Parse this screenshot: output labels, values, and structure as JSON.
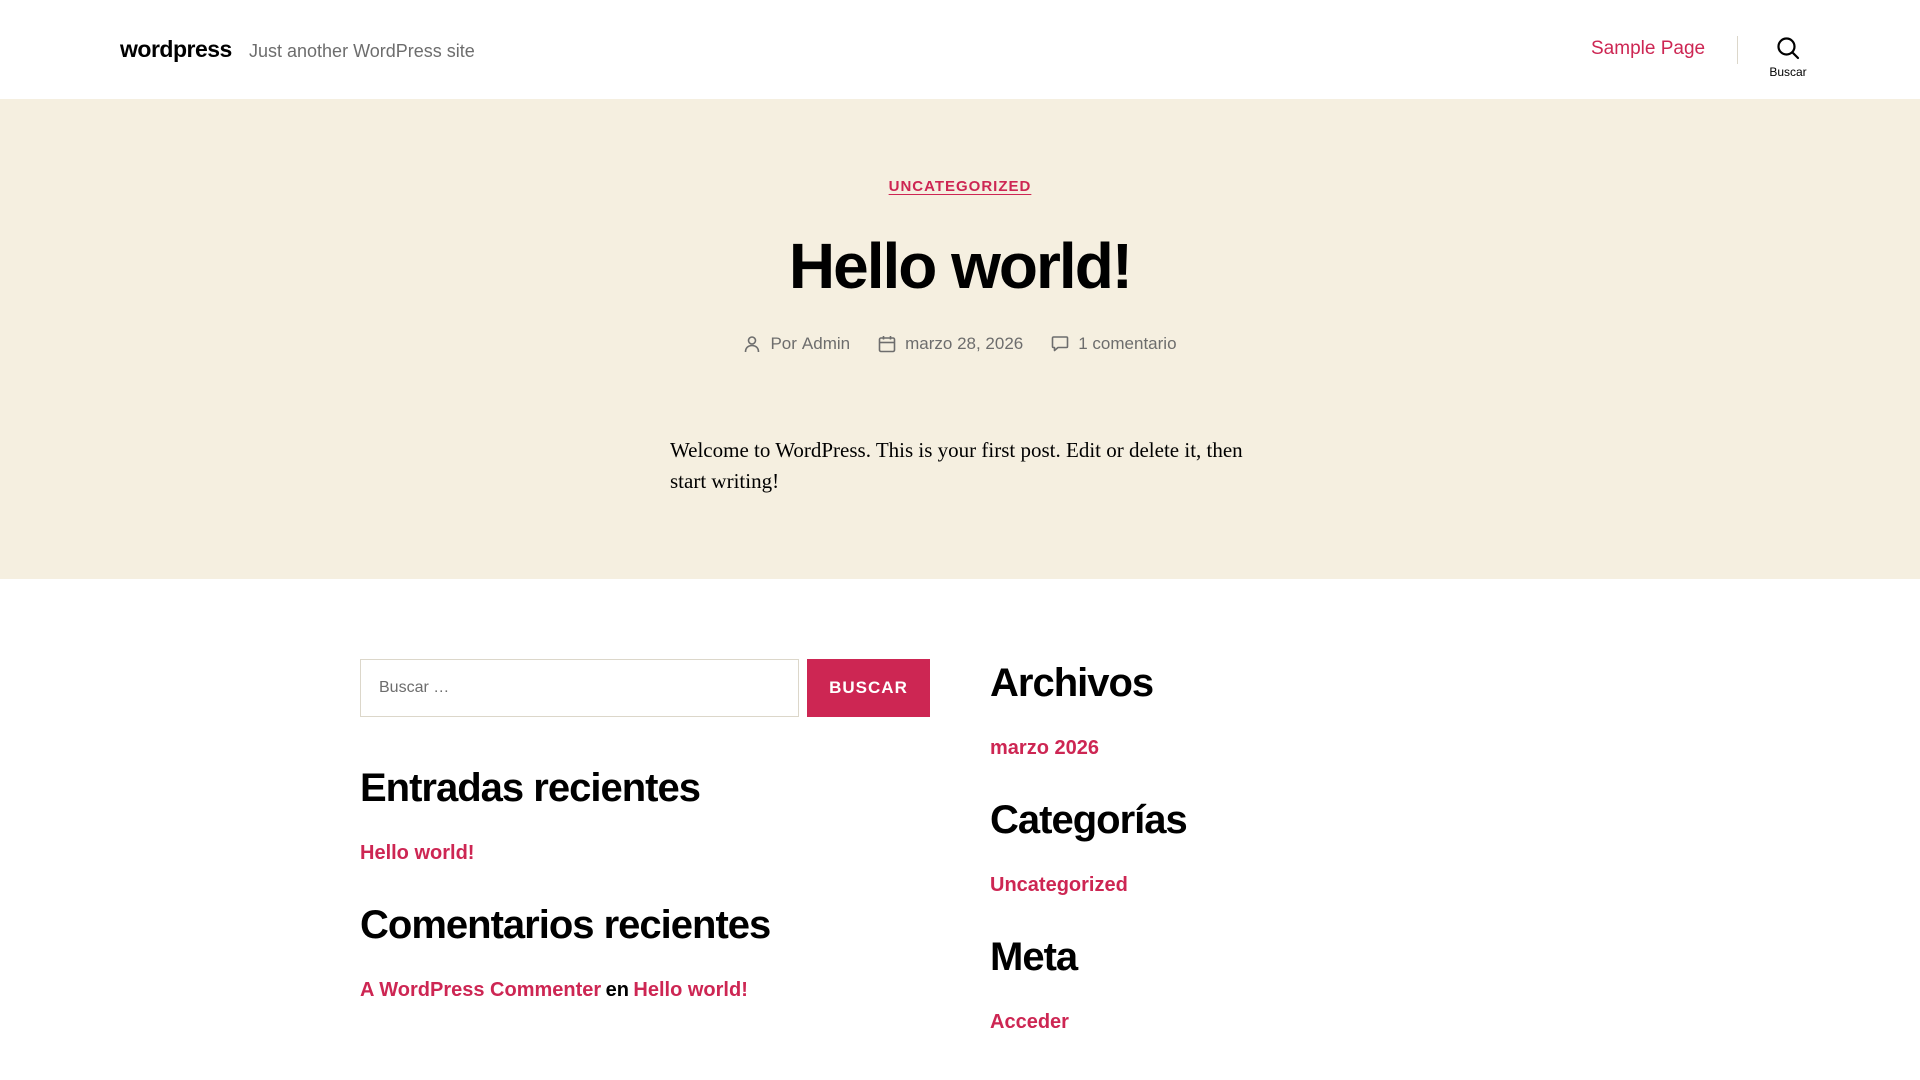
{
  "header": {
    "site_title": "wordpress",
    "site_description": "Just another WordPress site",
    "nav": [
      {
        "label": "Sample Page"
      }
    ],
    "search_toggle_label": "Buscar"
  },
  "post": {
    "category": "UNCATEGORIZED",
    "title": "Hello world!",
    "author_prefix": "Por",
    "author": "Admin",
    "date": "marzo 28, 2026",
    "comments": "1 comentario",
    "content": "Welcome to WordPress. This is your first post. Edit or delete it, then start writing!"
  },
  "widgets": {
    "search": {
      "placeholder": "Buscar …",
      "button_label": "BUSCAR"
    },
    "recent_posts": {
      "title": "Entradas recientes",
      "items": [
        "Hello world!"
      ]
    },
    "recent_comments": {
      "title": "Comentarios recientes",
      "items": [
        {
          "author": "A WordPress Commenter",
          "connector": "en",
          "post": "Hello world!"
        }
      ]
    },
    "archives": {
      "title": "Archivos",
      "items": [
        "marzo 2026"
      ]
    },
    "categories": {
      "title": "Categorías",
      "items": [
        "Uncategorized"
      ]
    },
    "meta": {
      "title": "Meta",
      "items": [
        "Acceder"
      ]
    }
  },
  "colors": {
    "accent": "#cd2653",
    "hero_background": "#f5efe0",
    "secondary_text": "#6d6d6d",
    "border": "#dcd7ca"
  }
}
